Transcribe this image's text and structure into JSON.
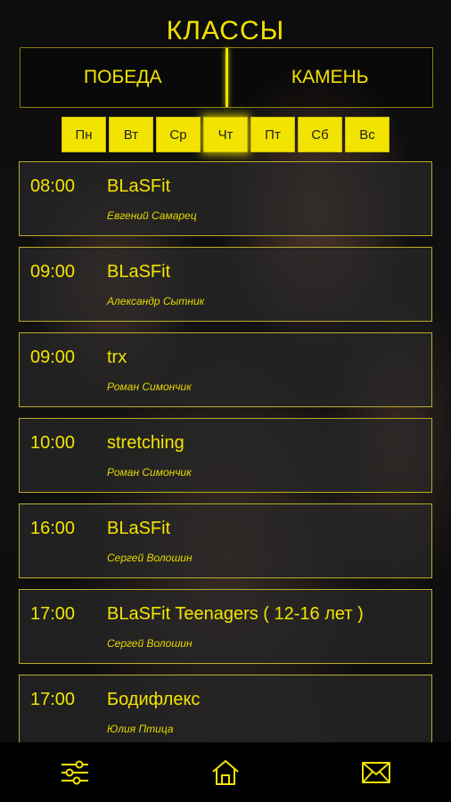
{
  "header": {
    "title": "КЛАССЫ"
  },
  "locations": [
    "ПОБЕДА",
    "КАМЕНЬ"
  ],
  "days": [
    {
      "label": "Пн",
      "active": false
    },
    {
      "label": "Вт",
      "active": false
    },
    {
      "label": "Ср",
      "active": false
    },
    {
      "label": "Чт",
      "active": true
    },
    {
      "label": "Пт",
      "active": false
    },
    {
      "label": "Сб",
      "active": false
    },
    {
      "label": "Вс",
      "active": false
    }
  ],
  "classes": [
    {
      "time": "08:00",
      "name": "BLaSFit",
      "coach": "Евгений Самарец"
    },
    {
      "time": "09:00",
      "name": "BLaSFit",
      "coach": "Александр Сытник"
    },
    {
      "time": "09:00",
      "name": "trx",
      "coach": "Роман Симончик"
    },
    {
      "time": "10:00",
      "name": "stretching",
      "coach": "Роман Симончик"
    },
    {
      "time": "16:00",
      "name": "BLaSFit",
      "coach": "Сергей Волошин"
    },
    {
      "time": "17:00",
      "name": "BLaSFit Teenagers ( 12-16 лет )",
      "coach": "Сергей Волошин"
    },
    {
      "time": "17:00",
      "name": "Бодифлекс",
      "coach": "Юлия Птица"
    }
  ],
  "nav": [
    "filter-icon",
    "home-icon",
    "mail-icon"
  ],
  "colors": {
    "accent": "#f3e300",
    "card_border": "#b8ad2a"
  }
}
